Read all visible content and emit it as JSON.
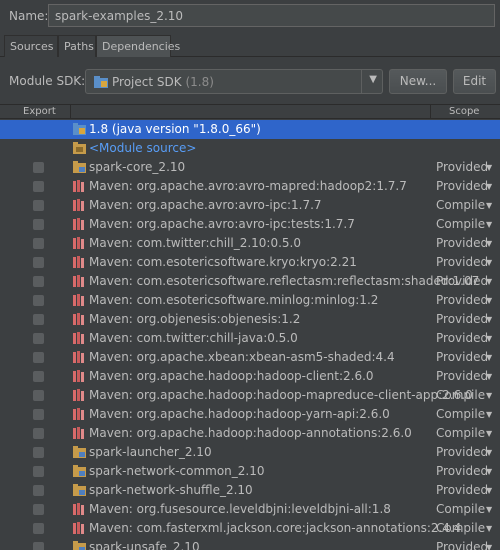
{
  "name_label": "Name:",
  "name_value": "spark-examples_2.10",
  "tabs": [
    {
      "label": "Sources",
      "active": false
    },
    {
      "label": "Paths",
      "active": false
    },
    {
      "label": "Dependencies",
      "active": true
    }
  ],
  "sdk": {
    "label": "Module SDK:",
    "selected": "Project SDK",
    "version": "(1.8)",
    "new_button": "New...",
    "edit_button": "Edit"
  },
  "table": {
    "header_export": "Export",
    "header_scope": "Scope",
    "rows": [
      {
        "text": "1.8 (java version \"1.8.0_66\")",
        "icon": "sdk-folder-icon",
        "checkbox": false,
        "scope": "",
        "selected": true,
        "link": false
      },
      {
        "text": "<Module source>",
        "icon": "source-folder-icon",
        "checkbox": false,
        "scope": "",
        "selected": false,
        "link": true
      },
      {
        "text": "spark-core_2.10",
        "icon": "module-folder-icon",
        "checkbox": true,
        "scope": "Provided",
        "selected": false,
        "link": false
      },
      {
        "text": "Maven: org.apache.avro:avro-mapred:hadoop2:1.7.7",
        "icon": "library-icon",
        "checkbox": true,
        "scope": "Provided",
        "selected": false,
        "link": false
      },
      {
        "text": "Maven: org.apache.avro:avro-ipc:1.7.7",
        "icon": "library-icon",
        "checkbox": true,
        "scope": "Compile",
        "selected": false,
        "link": false
      },
      {
        "text": "Maven: org.apache.avro:avro-ipc:tests:1.7.7",
        "icon": "library-icon",
        "checkbox": true,
        "scope": "Compile",
        "selected": false,
        "link": false
      },
      {
        "text": "Maven: com.twitter:chill_2.10:0.5.0",
        "icon": "library-icon",
        "checkbox": true,
        "scope": "Provided",
        "selected": false,
        "link": false
      },
      {
        "text": "Maven: com.esotericsoftware.kryo:kryo:2.21",
        "icon": "library-icon",
        "checkbox": true,
        "scope": "Provided",
        "selected": false,
        "link": false
      },
      {
        "text": "Maven: com.esotericsoftware.reflectasm:reflectasm:shaded:1.07",
        "icon": "library-icon",
        "checkbox": true,
        "scope": "Provided",
        "selected": false,
        "link": false
      },
      {
        "text": "Maven: com.esotericsoftware.minlog:minlog:1.2",
        "icon": "library-icon",
        "checkbox": true,
        "scope": "Provided",
        "selected": false,
        "link": false
      },
      {
        "text": "Maven: org.objenesis:objenesis:1.2",
        "icon": "library-icon",
        "checkbox": true,
        "scope": "Provided",
        "selected": false,
        "link": false
      },
      {
        "text": "Maven: com.twitter:chill-java:0.5.0",
        "icon": "library-icon",
        "checkbox": true,
        "scope": "Provided",
        "selected": false,
        "link": false
      },
      {
        "text": "Maven: org.apache.xbean:xbean-asm5-shaded:4.4",
        "icon": "library-icon",
        "checkbox": true,
        "scope": "Provided",
        "selected": false,
        "link": false
      },
      {
        "text": "Maven: org.apache.hadoop:hadoop-client:2.6.0",
        "icon": "library-icon",
        "checkbox": true,
        "scope": "Provided",
        "selected": false,
        "link": false
      },
      {
        "text": "Maven: org.apache.hadoop:hadoop-mapreduce-client-app:2.6.0",
        "icon": "library-icon",
        "checkbox": true,
        "scope": "Compile",
        "selected": false,
        "link": false
      },
      {
        "text": "Maven: org.apache.hadoop:hadoop-yarn-api:2.6.0",
        "icon": "library-icon",
        "checkbox": true,
        "scope": "Compile",
        "selected": false,
        "link": false
      },
      {
        "text": "Maven: org.apache.hadoop:hadoop-annotations:2.6.0",
        "icon": "library-icon",
        "checkbox": true,
        "scope": "Compile",
        "selected": false,
        "link": false
      },
      {
        "text": "spark-launcher_2.10",
        "icon": "module-folder-icon",
        "checkbox": true,
        "scope": "Provided",
        "selected": false,
        "link": false
      },
      {
        "text": "spark-network-common_2.10",
        "icon": "module-folder-icon",
        "checkbox": true,
        "scope": "Provided",
        "selected": false,
        "link": false
      },
      {
        "text": "spark-network-shuffle_2.10",
        "icon": "module-folder-icon",
        "checkbox": true,
        "scope": "Provided",
        "selected": false,
        "link": false
      },
      {
        "text": "Maven: org.fusesource.leveldbjni:leveldbjni-all:1.8",
        "icon": "library-icon",
        "checkbox": true,
        "scope": "Compile",
        "selected": false,
        "link": false
      },
      {
        "text": "Maven: com.fasterxml.jackson.core:jackson-annotations:2.4.4",
        "icon": "library-icon",
        "checkbox": true,
        "scope": "Compile",
        "selected": false,
        "link": false
      },
      {
        "text": "spark-unsafe_2.10",
        "icon": "module-folder-icon",
        "checkbox": true,
        "scope": "Provided",
        "selected": false,
        "link": false
      }
    ]
  }
}
